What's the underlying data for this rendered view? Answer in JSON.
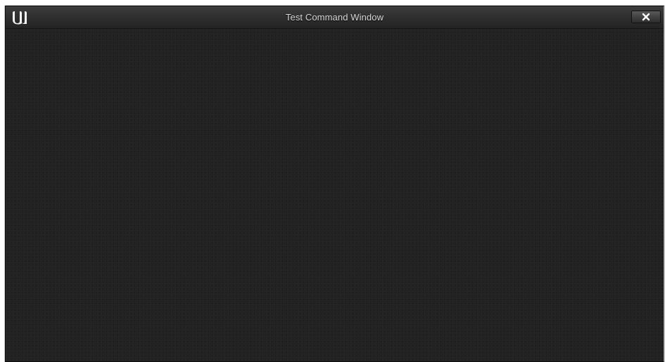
{
  "window": {
    "title": "Test Command Window",
    "logo_icon": "unreal-engine-logo-icon",
    "close_icon": "close-icon"
  },
  "colors": {
    "titlebar": "#303030",
    "content_background": "#222222",
    "title_text": "#d9d9d9"
  }
}
